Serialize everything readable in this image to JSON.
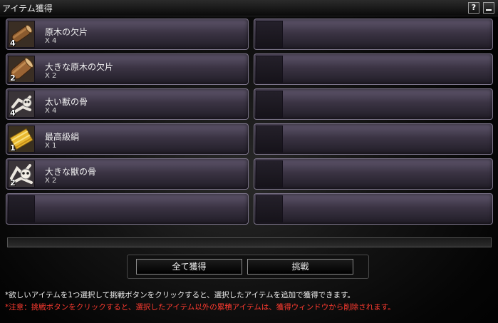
{
  "window": {
    "title": "アイテム獲得",
    "help_label": "?"
  },
  "items": [
    {
      "name": "原木の欠片",
      "qty": "X 4",
      "stack": "4",
      "icon": "wood-log-icon"
    },
    {
      "name": "大きな原木の欠片",
      "qty": "X 2",
      "stack": "2",
      "icon": "large-wood-log-icon"
    },
    {
      "name": "太い獣の骨",
      "qty": "X 4",
      "stack": "4",
      "icon": "thick-bone-icon"
    },
    {
      "name": "最高級絹",
      "qty": "X 1",
      "stack": "1",
      "icon": "silk-scroll-icon"
    },
    {
      "name": "大きな獣の骨",
      "qty": "X 2",
      "stack": "2",
      "icon": "large-bone-icon"
    }
  ],
  "progress": {
    "value": 0
  },
  "buttons": {
    "acquire_all": "全て獲得",
    "challenge": "挑戦"
  },
  "notes": {
    "line1": "*欲しいアイテムを1つ選択して挑戦ボタンをクリックすると、選択したアイテムを追加で獲得できます。",
    "line2": "*注意：挑戦ボタンをクリックすると、選択したアイテム以外の累積アイテムは、獲得ウィンドウから削除されます。"
  },
  "colors": {
    "slot_border": "#7c748a",
    "warning_text": "#ff3b30"
  }
}
